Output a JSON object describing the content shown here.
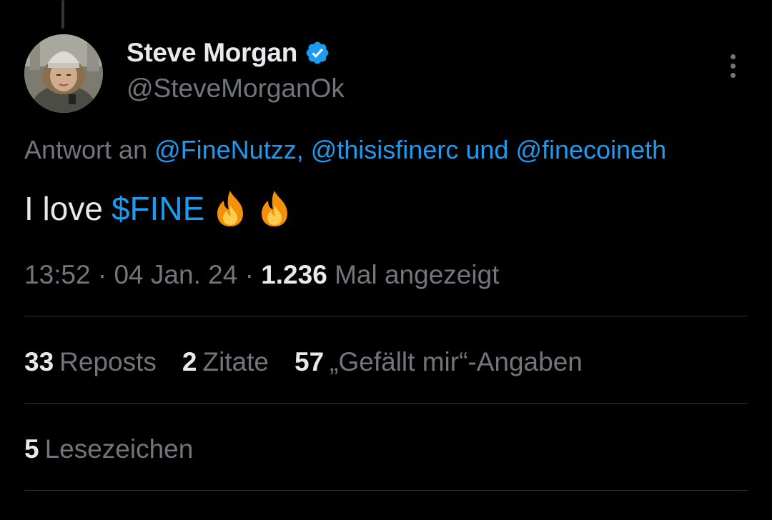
{
  "author": {
    "display_name": "Steve Morgan",
    "handle": "@SteveMorganOk",
    "verified_icon": "verified-badge-icon"
  },
  "reply": {
    "prefix": "Antwort an",
    "mentions": [
      "@FineNutzz,",
      "@thisisfinerc",
      "@finecoineth"
    ],
    "connector": "und"
  },
  "tweet": {
    "text_prefix": "I love",
    "cashtag": "$FINE",
    "emoji": [
      "fire-icon",
      "fire-icon"
    ]
  },
  "meta": {
    "time": "13:52",
    "separator": "·",
    "date": "04 Jan. 24",
    "views_count": "1.236",
    "views_label": "Mal angezeigt"
  },
  "stats": {
    "reposts_count": "33",
    "reposts_label": "Reposts",
    "quotes_count": "2",
    "quotes_label": "Zitate",
    "likes_count": "57",
    "likes_label": "„Gefällt mir“-Angaben",
    "bookmarks_count": "5",
    "bookmarks_label": "Lesezeichen"
  },
  "colors": {
    "background": "#000000",
    "primary_text": "#e7e9ea",
    "secondary_text": "#71767b",
    "link": "#1d9bf0",
    "verified": "#1d9bf0",
    "divider": "#2f3336"
  }
}
